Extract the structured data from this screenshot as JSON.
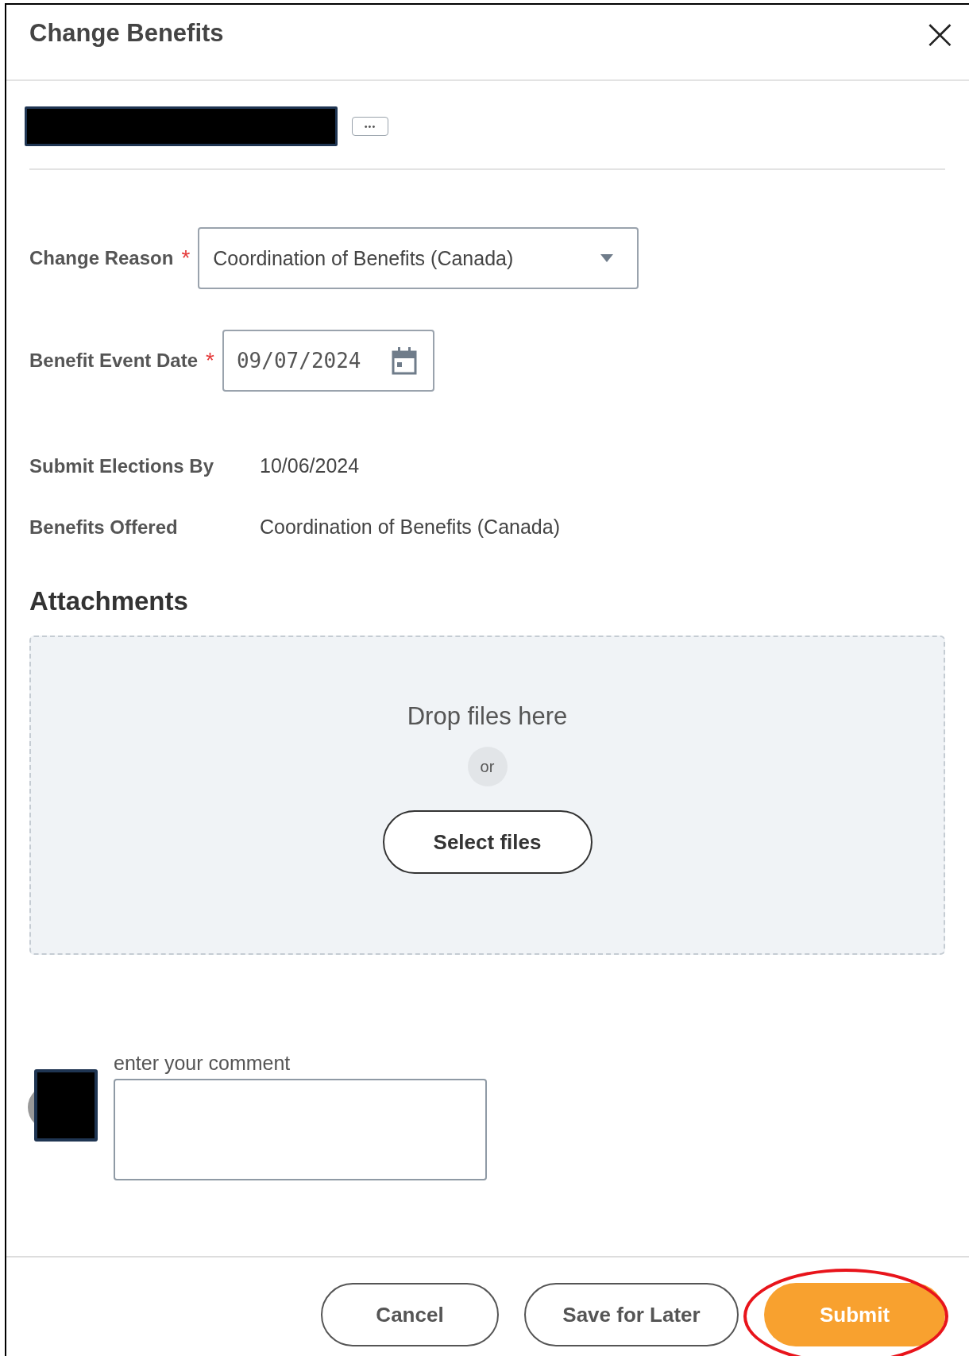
{
  "dialog": {
    "title": "Change Benefits",
    "close_label": "×"
  },
  "worker": {
    "more_label": "•••"
  },
  "fields": [
    {
      "kind": "select",
      "label": "Change Reason",
      "required_mark": "*",
      "value": "Coordination of Benefits (Canada)"
    },
    {
      "kind": "date",
      "label": "Benefit Event Date",
      "required_mark": "*",
      "value": "09/07/2024"
    },
    {
      "kind": "text",
      "label": "Submit Elections By",
      "value": "10/06/2024"
    },
    {
      "kind": "text",
      "label": "Benefits Offered",
      "value": "Coordination of Benefits (Canada)"
    }
  ],
  "attachments": {
    "heading": "Attachments",
    "drop_text": "Drop files here",
    "or_text": "or",
    "button": "Select files"
  },
  "comment": {
    "label": "enter your comment"
  },
  "buttons": [
    {
      "label": "Cancel",
      "kind": "secondary",
      "highlighted": false
    },
    {
      "label": "Save for Later",
      "kind": "secondary",
      "highlighted": false
    },
    {
      "label": "Submit",
      "kind": "primary",
      "highlighted": true
    }
  ]
}
